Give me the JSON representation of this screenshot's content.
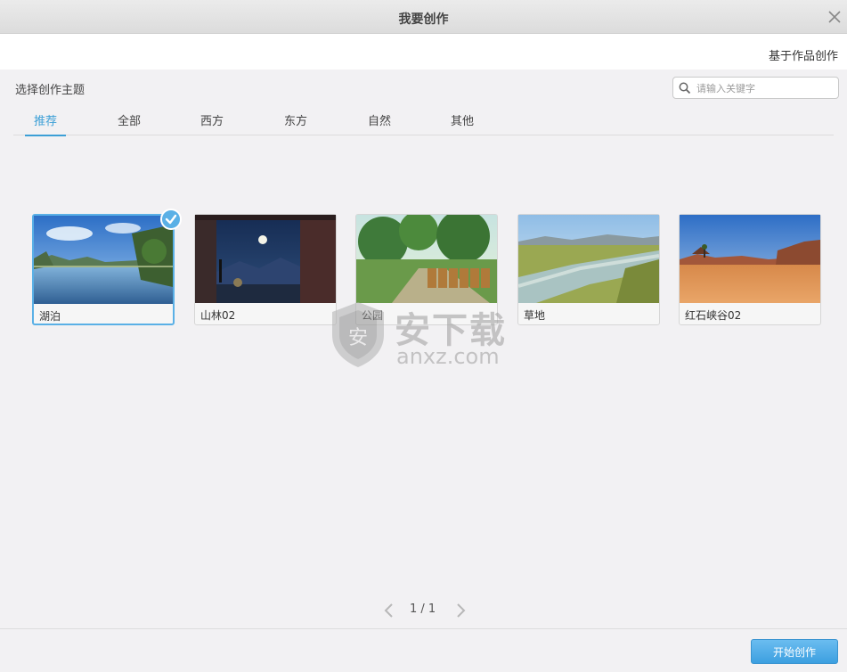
{
  "window": {
    "title": "我要创作",
    "close_icon": "close-icon"
  },
  "top": {
    "based_on_work": "基于作品创作"
  },
  "main": {
    "section_title": "选择创作主题",
    "search": {
      "placeholder": "请输入关键字",
      "value": "",
      "icon": "search-icon"
    },
    "tabs": [
      {
        "label": "推荐",
        "active": true
      },
      {
        "label": "全部",
        "active": false
      },
      {
        "label": "西方",
        "active": false
      },
      {
        "label": "东方",
        "active": false
      },
      {
        "label": "自然",
        "active": false
      },
      {
        "label": "其他",
        "active": false
      }
    ],
    "themes": [
      {
        "label": "湖泊",
        "selected": true,
        "icon": "lake-thumbnail"
      },
      {
        "label": "山林02",
        "selected": false,
        "icon": "mountain-forest-thumbnail"
      },
      {
        "label": "公园",
        "selected": false,
        "icon": "park-thumbnail"
      },
      {
        "label": "草地",
        "selected": false,
        "icon": "grassland-thumbnail"
      },
      {
        "label": "红石峡谷02",
        "selected": false,
        "icon": "red-canyon-thumbnail"
      }
    ],
    "pagination": {
      "text": "1 / 1"
    }
  },
  "watermark": {
    "cn": "安下载",
    "en": "anxz.com",
    "shield_char": "安"
  },
  "footer": {
    "start_button": "开始创作"
  },
  "colors": {
    "accent": "#3c9fd6",
    "button": "#4aa7e6",
    "selected_border": "#5ab0e6"
  }
}
